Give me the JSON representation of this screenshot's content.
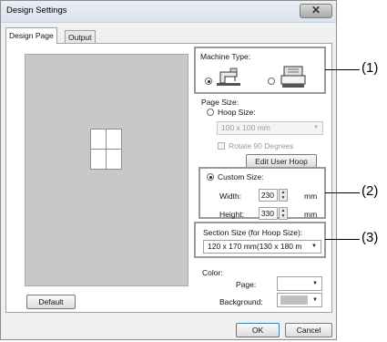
{
  "window": {
    "title": "Design Settings",
    "close_label": "✕"
  },
  "tabs": [
    {
      "label": "Design Page",
      "active": true
    },
    {
      "label": "Output",
      "active": false
    }
  ],
  "machine_type": {
    "label": "Machine Type:",
    "options": [
      {
        "icon": "sewing-machine-icon",
        "selected": true
      },
      {
        "icon": "embroidery-machine-icon",
        "selected": false
      }
    ]
  },
  "page_size": {
    "label": "Page Size:",
    "hoop_size": {
      "label": "Hoop Size:",
      "selected": false
    },
    "hoop_dropdown": {
      "value": "100 x 100 mm",
      "enabled": false
    },
    "rotate": {
      "label": "Rotate 90 Degrees",
      "checked": false,
      "enabled": false
    },
    "edit_user_hoop": {
      "label": "Edit User Hoop",
      "enabled": false
    },
    "custom_size": {
      "label": "Custom Size:",
      "selected": true
    },
    "width": {
      "label": "Width:",
      "value": "230",
      "unit": "mm"
    },
    "height": {
      "label": "Height:",
      "value": "330",
      "unit": "mm"
    }
  },
  "section_size": {
    "label": "Section Size (for Hoop Size):",
    "value": "120 x 170 mm(130 x 180 m"
  },
  "color": {
    "label": "Color:",
    "page": {
      "label": "Page:",
      "swatch": "#ffffff"
    },
    "background": {
      "label": "Background:",
      "swatch": "#bfbfbf"
    }
  },
  "buttons": {
    "default": "Default",
    "ok": "OK",
    "cancel": "Cancel"
  },
  "callouts": [
    "(1)",
    "(2)",
    "(3)"
  ]
}
